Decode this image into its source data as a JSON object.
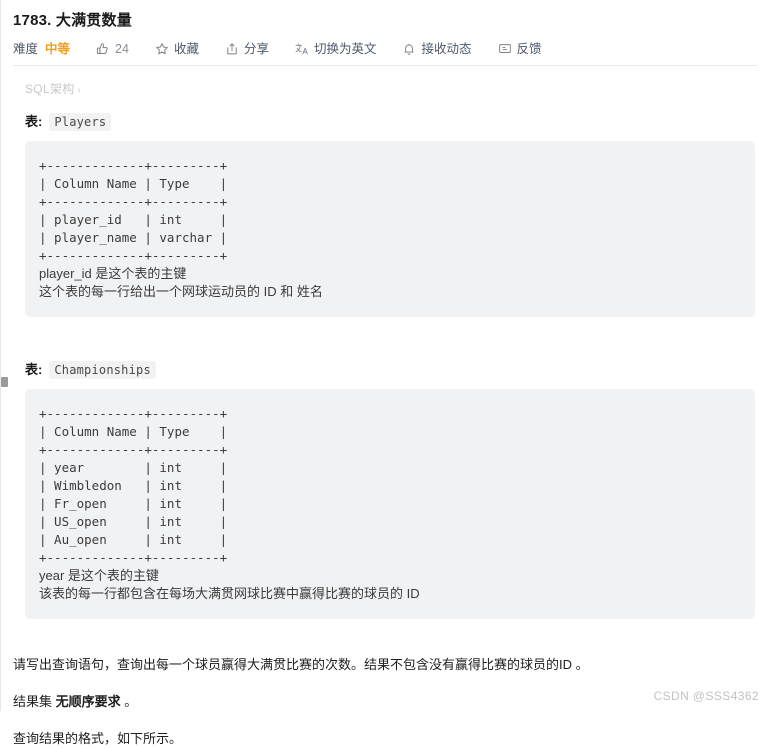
{
  "problem": {
    "title": "1783. 大满贯数量"
  },
  "toolbar": {
    "difficulty_label": "难度",
    "difficulty_value": "中等",
    "difficulty_color": "#f0a020",
    "items": [
      {
        "icon": "thumbs-up-icon",
        "label": "24"
      },
      {
        "icon": "star-icon",
        "label": "收藏"
      },
      {
        "icon": "share-icon",
        "label": "分享"
      },
      {
        "icon": "translate-icon",
        "label": "切换为英文"
      },
      {
        "icon": "bell-icon",
        "label": "接收动态"
      },
      {
        "icon": "feedback-icon",
        "label": "反馈"
      }
    ]
  },
  "schema": {
    "toggle_label": "SQL架构",
    "toggle_chevron": "›",
    "table_word": "表",
    "colon": ":",
    "tables": [
      {
        "name": "Players",
        "ascii": "+-------------+---------+\n| Column Name | Type    |\n+-------------+---------+\n| player_id   | int     |\n| player_name | varchar |\n+-------------+---------+",
        "notes": [
          "player_id 是这个表的主键",
          "这个表的每一行给出一个网球运动员的 ID 和 姓名"
        ]
      },
      {
        "name": "Championships",
        "ascii": "+-------------+---------+\n| Column Name | Type    |\n+-------------+---------+\n| year        | int     |\n| Wimbledon   | int     |\n| Fr_open     | int     |\n| US_open     | int     |\n| Au_open     | int     |\n+-------------+---------+",
        "notes": [
          "year 是这个表的主键",
          "该表的每一行都包含在每场大满贯网球比赛中赢得比赛的球员的 ID"
        ]
      }
    ]
  },
  "description": {
    "paragraph_1": "请写出查询语句，查询出每一个球员赢得大满贯比赛的次数。结果不包含没有赢得比赛的球员的ID 。",
    "paragraph_2_prefix": "结果集 ",
    "paragraph_2_bold": "无顺序要求",
    "paragraph_2_suffix": " 。",
    "paragraph_3": "查询结果的格式，如下所示。"
  },
  "watermark": "CSDN @SSS4362"
}
